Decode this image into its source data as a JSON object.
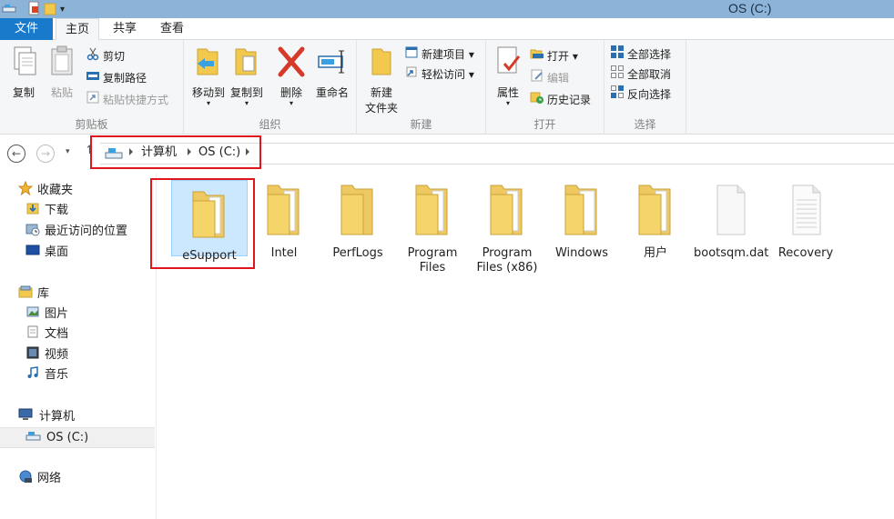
{
  "window": {
    "title": "OS (C:)"
  },
  "tabs": [
    {
      "label": "文件"
    },
    {
      "label": "主页"
    },
    {
      "label": "共享"
    },
    {
      "label": "查看"
    }
  ],
  "ribbon": {
    "clipboard": {
      "label": "剪贴板",
      "copy": "复制",
      "paste": "粘贴",
      "cut": "剪切",
      "copy_path": "复制路径",
      "paste_shortcut": "粘贴快捷方式"
    },
    "organize": {
      "label": "组织",
      "move_to": "移动到",
      "copy_to": "复制到",
      "delete": "删除",
      "rename": "重命名"
    },
    "new": {
      "label": "新建",
      "new_folder_line1": "新建",
      "new_folder_line2": "文件夹",
      "new_item": "新建项目 ▾",
      "easy_access": "轻松访问 ▾"
    },
    "open": {
      "label": "打开",
      "properties": "属性",
      "open": "打开 ▾",
      "edit": "编辑",
      "history": "历史记录"
    },
    "select": {
      "label": "选择",
      "select_all": "全部选择",
      "select_none": "全部取消",
      "invert": "反向选择"
    }
  },
  "address": {
    "crumbs": [
      "计算机",
      "OS (C:)"
    ]
  },
  "nav": {
    "favorites": "收藏夹",
    "downloads": "下载",
    "recent": "最近访问的位置",
    "desktop": "桌面",
    "libraries": "库",
    "pictures": "图片",
    "documents": "文档",
    "videos": "视频",
    "music": "音乐",
    "computer": "计算机",
    "os_c": "OS (C:)",
    "network": "网络"
  },
  "files": [
    {
      "name": "eSupport",
      "type": "folder"
    },
    {
      "name": "Intel",
      "type": "folder"
    },
    {
      "name": "PerfLogs",
      "type": "folder"
    },
    {
      "name": "Program Files",
      "type": "folder"
    },
    {
      "name": "Program Files (x86)",
      "type": "folder"
    },
    {
      "name": "Windows",
      "type": "folder"
    },
    {
      "name": "用户",
      "type": "folder"
    },
    {
      "name": "bootsqm.dat",
      "type": "file"
    },
    {
      "name": "Recovery",
      "type": "file"
    }
  ],
  "colors": {
    "accent": "#1979ca",
    "highlight": "#e0161c",
    "selection": "#cce8ff",
    "titlebar": "#8cb4d8"
  }
}
